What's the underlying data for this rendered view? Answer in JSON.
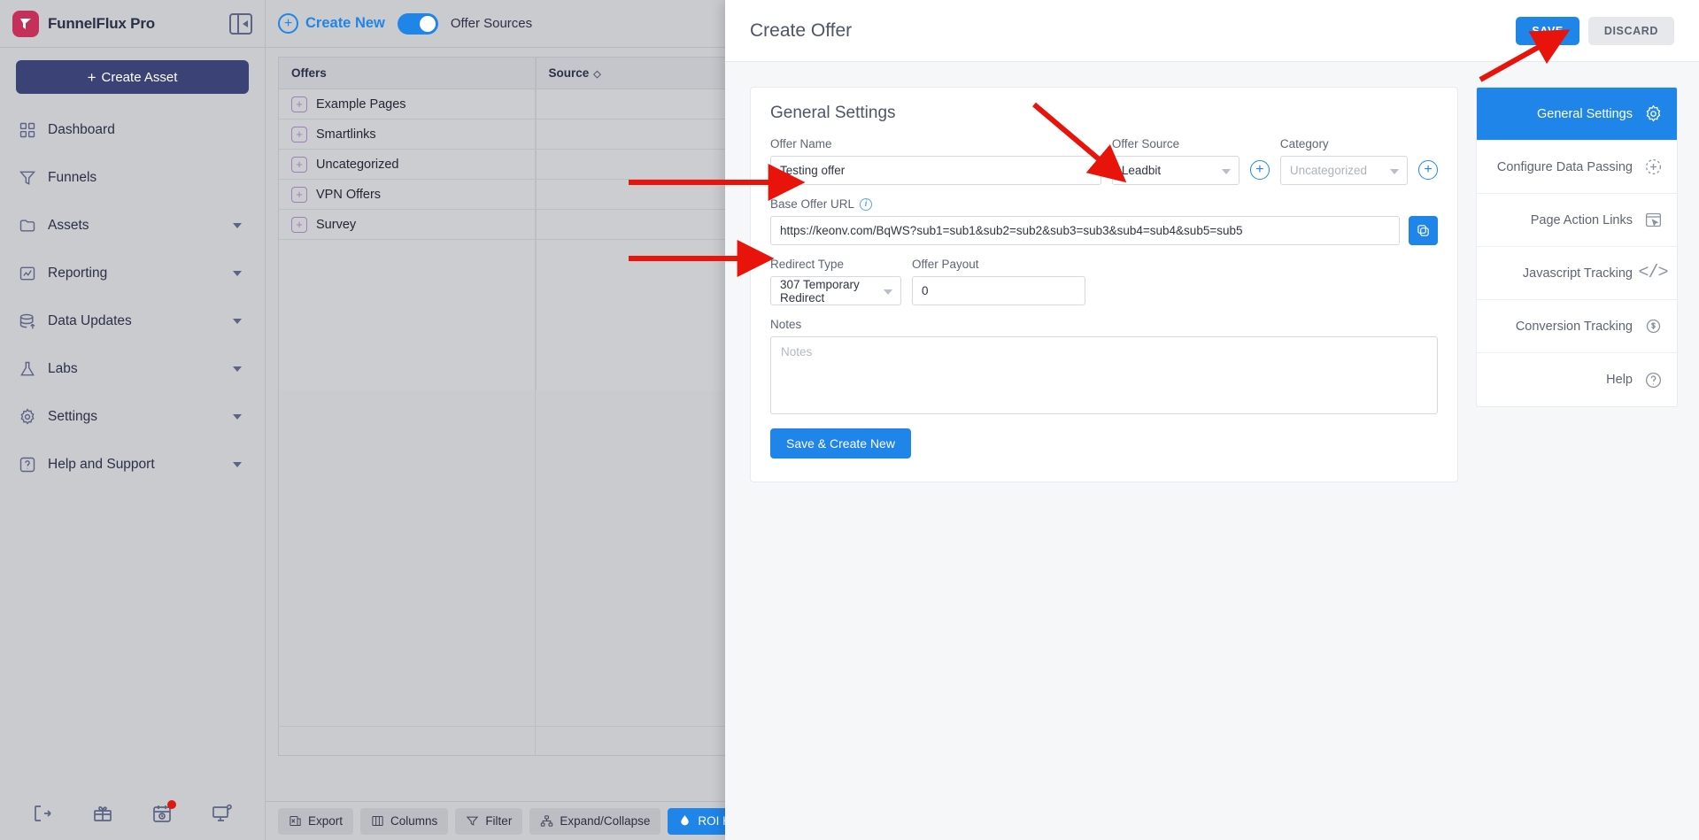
{
  "sidebar": {
    "brand": "FunnelFlux Pro",
    "collapse_icon": "panel-collapse-icon",
    "create_asset_label": "Create Asset",
    "items": [
      {
        "label": "Dashboard",
        "icon": "grid-icon",
        "expandable": false
      },
      {
        "label": "Funnels",
        "icon": "funnel-icon",
        "expandable": false
      },
      {
        "label": "Assets",
        "icon": "folder-icon",
        "expandable": true
      },
      {
        "label": "Reporting",
        "icon": "chart-report-icon",
        "expandable": true
      },
      {
        "label": "Data Updates",
        "icon": "database-upload-icon",
        "expandable": true
      },
      {
        "label": "Labs",
        "icon": "flask-icon",
        "expandable": true
      },
      {
        "label": "Settings",
        "icon": "gear-icon",
        "expandable": true
      },
      {
        "label": "Help and Support",
        "icon": "question-box-icon",
        "expandable": true
      }
    ],
    "footer_icons": [
      {
        "name": "logout-icon",
        "badge": false
      },
      {
        "name": "gift-icon",
        "badge": false
      },
      {
        "name": "calendar-clock-icon",
        "badge": true
      },
      {
        "name": "screen-help-icon",
        "badge": false
      }
    ]
  },
  "main": {
    "create_new_label": "Create New",
    "toggle_label": "Offer Sources",
    "toggle_on": true,
    "table": {
      "columns": [
        "Offers",
        "Source"
      ],
      "sort_icon": "sort-updown-icon",
      "rows": [
        {
          "offer": "Example Pages",
          "source": ""
        },
        {
          "offer": "Smartlinks",
          "source": ""
        },
        {
          "offer": "Uncategorized",
          "source": ""
        },
        {
          "offer": "VPN Offers",
          "source": ""
        },
        {
          "offer": "Survey",
          "source": ""
        }
      ],
      "expand_glyph": "+"
    },
    "bottom_bar": [
      {
        "label": "Export",
        "icon": "export-excel-icon",
        "accent": false
      },
      {
        "label": "Columns",
        "icon": "columns-icon",
        "accent": false
      },
      {
        "label": "Filter",
        "icon": "filter-icon",
        "accent": false
      },
      {
        "label": "Expand/Collapse",
        "icon": "tree-expand-icon",
        "accent": false
      },
      {
        "label": "ROI Highlighting",
        "icon": "droplet-icon",
        "accent": true
      }
    ]
  },
  "panel": {
    "title": "Create Offer",
    "save_label": "SAVE",
    "discard_label": "DISCARD",
    "card_title": "General Settings",
    "fields": {
      "offer_name_label": "Offer Name",
      "offer_name_value": "Testing offer",
      "offer_source_label": "Offer Source",
      "offer_source_value": "Leadbit",
      "category_label": "Category",
      "category_placeholder": "Uncategorized",
      "base_url_label": "Base Offer URL",
      "base_url_value": "https://keonv.com/BqWS?sub1=sub1&sub2=sub2&sub3=sub3&sub4=sub4&sub5=sub5",
      "redirect_type_label": "Redirect Type",
      "redirect_type_value": "307 Temporary Redirect",
      "offer_payout_label": "Offer Payout",
      "offer_payout_value": "0",
      "notes_label": "Notes",
      "notes_placeholder": "Notes",
      "save_create_new_label": "Save & Create New"
    },
    "menu": [
      {
        "label": "General Settings",
        "icon": "gear-icon",
        "active": true
      },
      {
        "label": "Configure Data Passing",
        "icon": "plus-circle-dashed-icon",
        "active": false
      },
      {
        "label": "Page Action Links",
        "icon": "browser-click-icon",
        "active": false
      },
      {
        "label": "Javascript Tracking",
        "icon": "code-brackets-icon",
        "active": false
      },
      {
        "label": "Conversion Tracking",
        "icon": "dollar-refresh-icon",
        "active": false
      },
      {
        "label": "Help",
        "icon": "question-circle-icon",
        "active": false
      }
    ]
  },
  "colors": {
    "accent_blue": "#1f85e8",
    "brand_red": "#c5305a",
    "sidebar_navy": "#3b4275",
    "annotation_red": "#e8130a"
  }
}
